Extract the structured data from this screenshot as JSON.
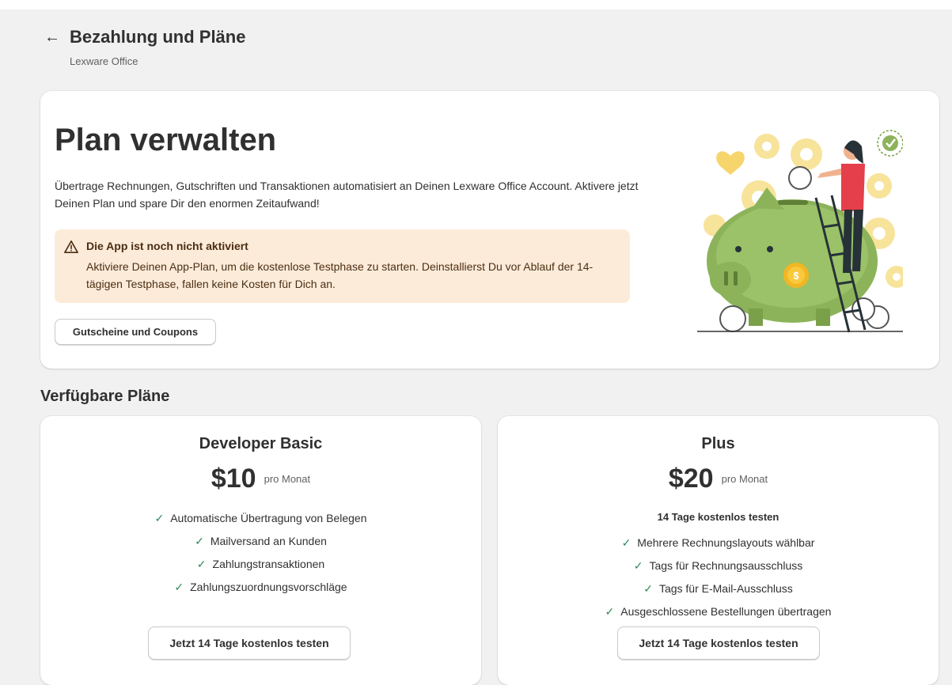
{
  "header": {
    "back_icon": "arrow-left-icon",
    "title": "Bezahlung und Pläne",
    "subtitle": "Lexware Office"
  },
  "hero": {
    "title": "Plan verwalten",
    "description": "Übertrage Rechnungen, Gutschriften und Transaktionen automatisiert an Deinen Lexware Office Account. Aktivere jetzt Deinen Plan und spare Dir den enormen Zeitaufwand!",
    "banner": {
      "icon": "warning-icon",
      "title": "Die App ist noch nicht aktiviert",
      "text": "Aktiviere Deinen App-Plan, um die kostenlose Testphase zu starten. Deinstallierst Du vor Ablauf der 14-tägigen Testphase, fallen keine Kosten für Dich an.",
      "background": "#fdebda"
    },
    "coupon_button": "Gutscheine und Coupons",
    "illustration": "piggy-bank-illustration"
  },
  "plans_section": {
    "title": "Verfügbare Pläne",
    "plans": [
      {
        "name": "Developer Basic",
        "price": "$10",
        "period": "pro Monat",
        "features": [
          "Automatische Übertragung von Belegen",
          "Mailversand an Kunden",
          "Zahlungstransaktionen",
          "Zahlungszuordnungsvorschläge"
        ],
        "button": "Jetzt 14 Tage kostenlos testen"
      },
      {
        "name": "Plus",
        "price": "$20",
        "period": "pro Monat",
        "trial_note": "14 Tage kostenlos testen",
        "features": [
          "Mehrere Rechnungslayouts wählbar",
          "Tags für Rechnungsausschluss",
          "Tags für E-Mail-Ausschluss",
          "Ausgeschlossene Bestellungen übertragen"
        ],
        "button": "Jetzt 14 Tage kostenlos testen"
      }
    ]
  },
  "colors": {
    "check": "#2f8a5b",
    "page_background": "#f1f1f1"
  }
}
